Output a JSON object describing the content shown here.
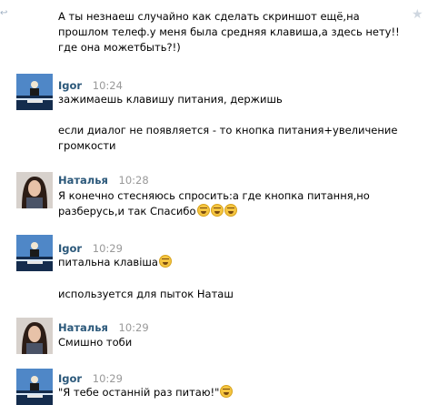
{
  "messages": [
    {
      "author": "",
      "time": "",
      "lines": [
        "А ты незнаеш случайно как сделать скриншот ещё,на",
        "прошлом телеф.у меня была средняя клавиша,а здесь нету!!",
        "где она можетбыть?!)"
      ]
    },
    {
      "author": "Igor",
      "time": "10:24",
      "lines": [
        "зажимаешь клавишу питания, держишь",
        "если диалог не появляется - то кнопка питания+увеличение",
        "громкости"
      ]
    },
    {
      "author": "Наталья",
      "time": "10:28",
      "lines": [
        "Я конечно стесняюсь спросить:а где кнопка питання,но",
        "разберусь,и так Спасибо"
      ]
    },
    {
      "author": "Igor",
      "time": "10:29",
      "lines": [
        "питальна клавіша",
        "используется для пыток Наташ"
      ]
    },
    {
      "author": "Наталья",
      "time": "10:29",
      "lines": [
        "Смишно тоби"
      ]
    },
    {
      "author": "Igor",
      "time": "10:29",
      "lines": [
        "\"Я тебе останній раз питаю!\""
      ]
    }
  ],
  "icons": {
    "reply": "reply-icon",
    "star": "star-icon",
    "emoji": "laughing-emoji-icon"
  },
  "colors": {
    "author": "#2b587a",
    "time": "#999999"
  }
}
